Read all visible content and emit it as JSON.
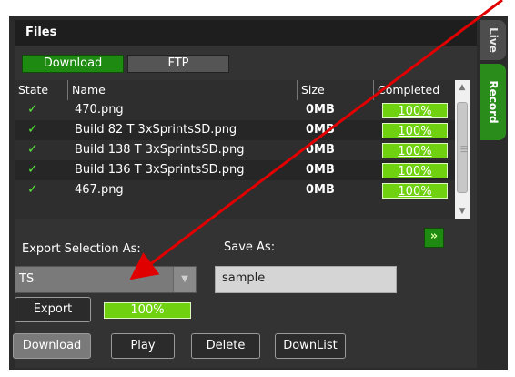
{
  "panel": {
    "title": "Files"
  },
  "side_tabs": {
    "live": "Live",
    "record": "Record"
  },
  "top_buttons": {
    "download": "Download",
    "ftp": "FTP"
  },
  "table": {
    "headers": {
      "state": "State",
      "name": "Name",
      "size": "Size",
      "completed": "Completed"
    },
    "rows": [
      {
        "state": "✓",
        "name": "470.png",
        "size": "0MB",
        "completed": "100%"
      },
      {
        "state": "✓",
        "name": "Build 82 T 3xSprintsSD.png",
        "size": "0MB",
        "completed": "100%"
      },
      {
        "state": "✓",
        "name": "Build 138 T 3xSprintsSD.png",
        "size": "0MB",
        "completed": "100%"
      },
      {
        "state": "✓",
        "name": "Build 136 T 3xSprintsSD.png",
        "size": "0MB",
        "completed": "100%"
      },
      {
        "state": "✓",
        "name": "467.png",
        "size": "0MB",
        "completed": "100%"
      }
    ]
  },
  "export": {
    "selection_label": "Export Selection As:",
    "selection_value": "TS",
    "save_as_label": "Save As:",
    "save_as_value": "sample",
    "export_button": "Export",
    "progress_label": "100%",
    "progress_value": 1.0
  },
  "bottom_buttons": {
    "download": "Download",
    "play": "Play",
    "delete": "Delete",
    "downlist": "DownList"
  },
  "icons": {
    "check": "check-icon",
    "expand": "double-chevron-down-icon",
    "dropdown": "triangle-down-icon",
    "scroll_up": "triangle-up-icon",
    "scroll_down": "triangle-down-icon"
  },
  "colors": {
    "accent_green": "#1f8a12",
    "progress_green": "#6fd10f",
    "check_green": "#56e63b",
    "annotation_red": "#e00000"
  }
}
